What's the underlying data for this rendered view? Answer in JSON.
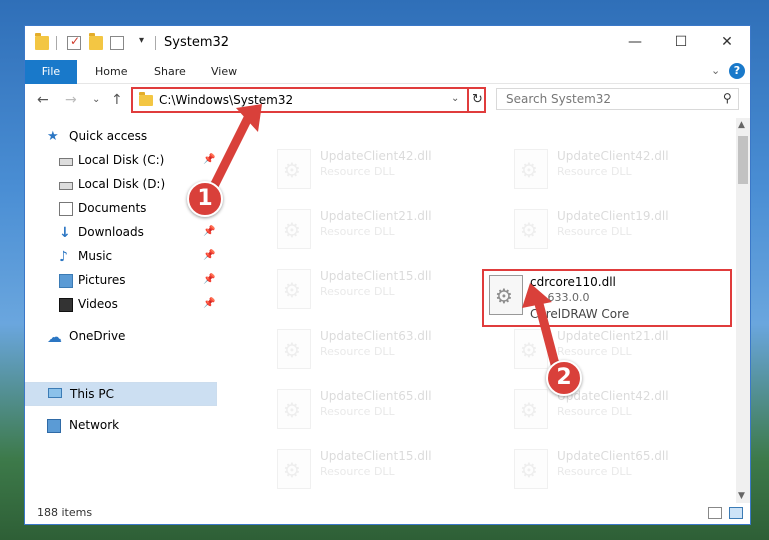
{
  "window": {
    "title": "System32",
    "controls": {
      "minimize": "—",
      "maximize": "☐",
      "close": "✕"
    }
  },
  "ribbon": {
    "tabs": [
      "File",
      "Home",
      "Share",
      "View"
    ],
    "expand": "⌄",
    "help": "?"
  },
  "navbar": {
    "back": "←",
    "forward": "→",
    "recent": "⌄",
    "up": "↑",
    "address": "C:\\Windows\\System32",
    "address_dropdown": "⌄",
    "refresh": "↻",
    "search_placeholder": "Search System32",
    "search_icon": "⚲"
  },
  "sidebar": {
    "items": [
      {
        "label": "Quick access",
        "icon": "star-icon",
        "pinned": false
      },
      {
        "label": "Local Disk (C:)",
        "icon": "disk-icon",
        "pinned": true
      },
      {
        "label": "Local Disk (D:)",
        "icon": "disk-icon",
        "pinned": false
      },
      {
        "label": "Documents",
        "icon": "documents-icon",
        "pinned": true
      },
      {
        "label": "Downloads",
        "icon": "download-icon",
        "pinned": true
      },
      {
        "label": "Music",
        "icon": "music-icon",
        "pinned": true
      },
      {
        "label": "Pictures",
        "icon": "pictures-icon",
        "pinned": true
      },
      {
        "label": "Videos",
        "icon": "videos-icon",
        "pinned": true
      },
      {
        "label": "OneDrive",
        "icon": "cloud-icon",
        "pinned": false
      },
      {
        "label": "This PC",
        "icon": "computer-icon",
        "pinned": false,
        "selected": true
      },
      {
        "label": "Network",
        "icon": "network-icon",
        "pinned": false
      }
    ],
    "pin_glyph": "📌"
  },
  "files": [
    {
      "name": "UpdateClient42.dll",
      "line2": "Resource DLL",
      "line3": ""
    },
    {
      "name": "UpdateClient42.dll",
      "line2": "Resource DLL",
      "line3": ""
    },
    {
      "name": "UpdateClient21.dll",
      "line2": "Resource DLL",
      "line3": ""
    },
    {
      "name": "UpdateClient19.dll",
      "line2": "Resource DLL",
      "line3": ""
    },
    {
      "name": "UpdateClient15.dll",
      "line2": "Resource DLL",
      "line3": ""
    },
    {
      "name": "cdrcore110.dll",
      "line2": "11.633.0.0",
      "line3": "CorelDRAW Core",
      "highlighted": true
    },
    {
      "name": "UpdateClient63.dll",
      "line2": "Resource DLL",
      "line3": ""
    },
    {
      "name": "UpdateClient21.dll",
      "line2": "Resource DLL",
      "line3": ""
    },
    {
      "name": "UpdateClient65.dll",
      "line2": "Resource DLL",
      "line3": ""
    },
    {
      "name": "UpdateClient42.dll",
      "line2": "Resource DLL",
      "line3": ""
    },
    {
      "name": "UpdateClient15.dll",
      "line2": "Resource DLL",
      "line3": ""
    },
    {
      "name": "UpdateClient65.dll",
      "line2": "Resource DLL",
      "line3": ""
    }
  ],
  "status": {
    "item_count": "188 items"
  },
  "annotations": {
    "badge1": "1",
    "badge2": "2",
    "color": "#d9403a"
  },
  "colors": {
    "accent": "#1979ca",
    "highlight_border": "#e03c3c",
    "selected_bg": "#ccdff2"
  }
}
